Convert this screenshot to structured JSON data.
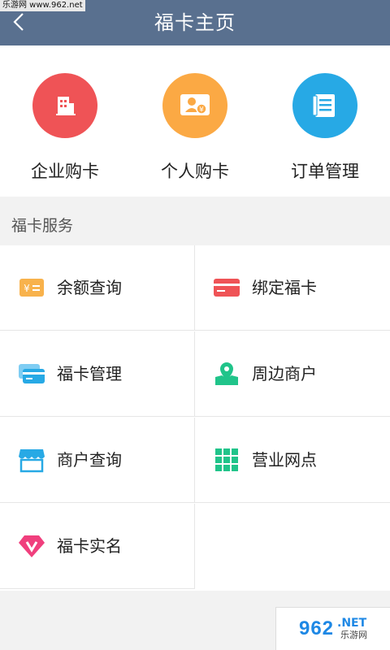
{
  "watermark": {
    "top_text": "乐游网 www.962.net",
    "bottom_logo": "962",
    "bottom_logo_net": ".NET",
    "bottom_cn": "乐游网"
  },
  "header": {
    "title": "福卡主页"
  },
  "quick_actions": [
    {
      "label": "企业购卡",
      "icon": "enterprise-card-icon",
      "color": "#ef5356"
    },
    {
      "label": "个人购卡",
      "icon": "personal-card-icon",
      "color": "#fba944"
    },
    {
      "label": "订单管理",
      "icon": "order-list-icon",
      "color": "#27a9e5"
    }
  ],
  "services": {
    "title": "福卡服务",
    "items": [
      {
        "label": "余额查询",
        "icon": "balance-icon",
        "color": "#f8b24c"
      },
      {
        "label": "绑定福卡",
        "icon": "bind-card-icon",
        "color": "#ef5356"
      },
      {
        "label": "福卡管理",
        "icon": "card-manage-icon",
        "color": "#27a9e5"
      },
      {
        "label": "周边商户",
        "icon": "nearby-map-icon",
        "color": "#20c48a"
      },
      {
        "label": "商户查询",
        "icon": "store-icon",
        "color": "#27a9e5"
      },
      {
        "label": "营业网点",
        "icon": "grid-outlets-icon",
        "color": "#20c48a"
      },
      {
        "label": "福卡实名",
        "icon": "diamond-v-icon",
        "color": "#f03f7d"
      }
    ]
  }
}
